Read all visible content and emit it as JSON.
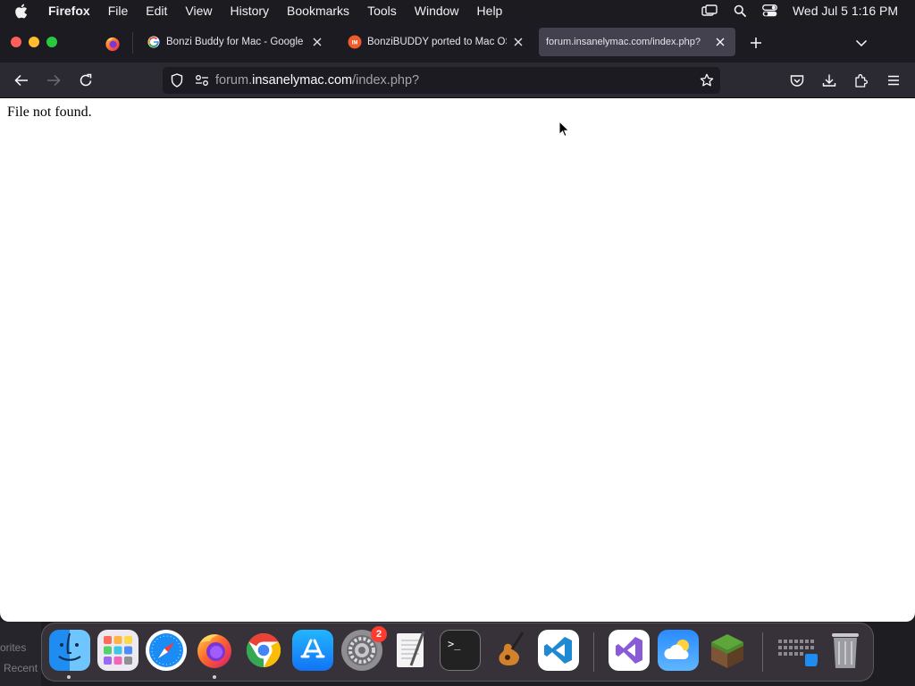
{
  "menubar": {
    "app_name": "Firefox",
    "items": [
      "File",
      "Edit",
      "View",
      "History",
      "Bookmarks",
      "Tools",
      "Window",
      "Help"
    ],
    "clock": "Wed Jul 5  1:16 PM"
  },
  "tabs": [
    {
      "title": "Bonzi Buddy for Mac - Google S",
      "favicon": "google-icon",
      "active": false
    },
    {
      "title": "BonziBUDDY ported to Mac OS",
      "favicon": "insanelymac-icon",
      "active": false
    },
    {
      "title": "forum.insanelymac.com/index.php?",
      "favicon": "none",
      "active": true
    }
  ],
  "urlbar": {
    "prefix": "forum.",
    "host": "insanelymac.com",
    "path": "/index.php?"
  },
  "page": {
    "text": "File not found."
  },
  "dock": {
    "apps": [
      "Finder",
      "Launchpad",
      "Safari",
      "Firefox",
      "Google Chrome",
      "App Store",
      "System Settings",
      "TextEdit",
      "Terminal",
      "GarageBand",
      "Visual Studio Code",
      "Visual Studio",
      "Weather",
      "Minecraft",
      "Downloads",
      "Trash"
    ],
    "settings_badge": "2"
  },
  "finder_sidebar": {
    "favorites": "orites",
    "recents": "Recent"
  },
  "colors": {
    "toolbar": "#2b2a33",
    "tabstrip": "#1c1b22",
    "active_tab": "#42414d",
    "close_red": "#ff5f57",
    "minimize_yellow": "#febc2e",
    "zoom_green": "#28c840"
  }
}
